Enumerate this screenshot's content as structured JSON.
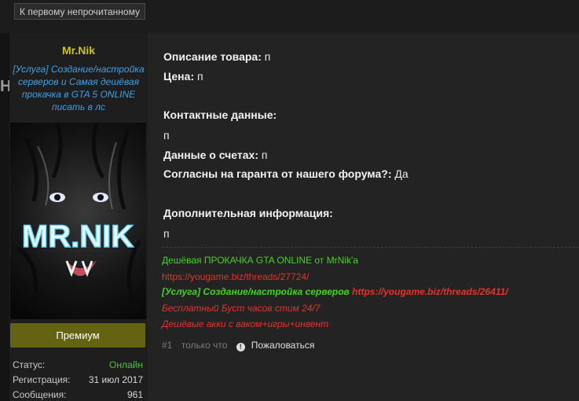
{
  "nav": {
    "unread_button": "К первому непрочитанному"
  },
  "side_strip": {
    "letters": "НА"
  },
  "user": {
    "name": "Mr.Nik",
    "title": "[Услуга] Создание/настройка серверов и Самая дешёвая прокачка в GTA 5 ONLINE писать в лс",
    "avatar_text": "MR.NIK",
    "rank_button": "Премиум",
    "stats": [
      {
        "label": "Статус:",
        "value": "Онлайн",
        "color": "#52c03a"
      },
      {
        "label": "Регистрация:",
        "value": "31 июл 2017",
        "color": "#d8d8d8"
      },
      {
        "label": "Сообщения:",
        "value": "961",
        "color": "#d8d8d8"
      }
    ]
  },
  "post": {
    "description": {
      "label": "Описание товара",
      "value": "п"
    },
    "price": {
      "label": "Цена",
      "value": "п"
    },
    "contacts": {
      "label": "Контактные данные",
      "value": "п"
    },
    "accounts": {
      "label": "Данные о счетах",
      "value": "п"
    },
    "guarantee": {
      "label": "Согласны на гаранта от нашего форума?",
      "value": "Да"
    },
    "additional": {
      "label": "Дополнительная информация",
      "value": "п"
    }
  },
  "signature": {
    "line1": "Дешёвая ПРОКАЧКА GTA ONLINE от MrNik'a",
    "line2": "https://yougame.biz/threads/27724/",
    "line3_text": "[Услуга] Создание/настройка серверов",
    "line3_link": "https://yougame.biz/threads/26411/",
    "line4": "Бесплатный Буст часов стим 24/7",
    "line5": "Дешёвые акки с вакoм+игры+инвент"
  },
  "footer": {
    "post_number": "#1",
    "time": "только что",
    "report": "Пожаловаться"
  }
}
